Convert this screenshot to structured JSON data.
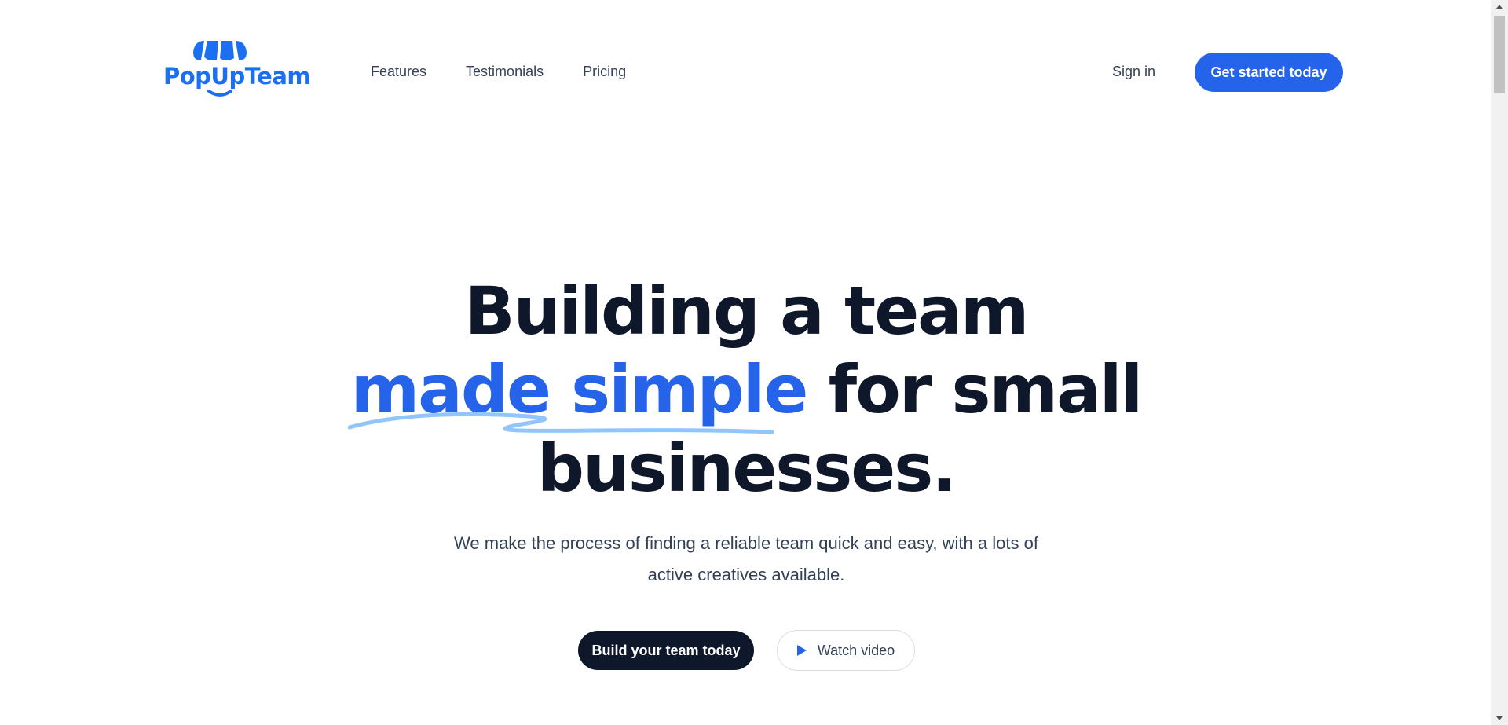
{
  "brand": {
    "name": "PopUpTeam",
    "color": "#1d6ff2"
  },
  "nav": {
    "items": [
      {
        "label": "Features"
      },
      {
        "label": "Testimonials"
      },
      {
        "label": "Pricing"
      }
    ],
    "signin_label": "Sign in",
    "cta_label": "Get started today"
  },
  "hero": {
    "title_line1": "Building a team",
    "title_highlight": "made simple",
    "title_line2_rest": " for small",
    "title_line3": "businesses.",
    "subtitle": "We make the process of finding a reliable team quick and easy, with a lots of active creatives available.",
    "primary_button": "Build your team today",
    "secondary_button": "Watch video"
  },
  "colors": {
    "accent": "#2563eb",
    "dark": "#0f172a",
    "text_muted": "#334155",
    "scribble": "#93c5fd"
  }
}
